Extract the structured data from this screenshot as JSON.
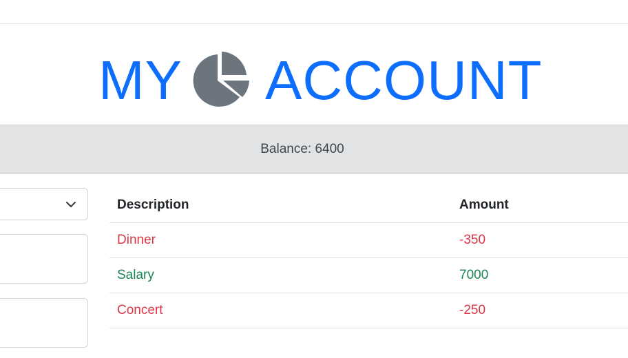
{
  "header": {
    "title_left": "MY",
    "title_right": "ACCOUNT",
    "icon": "pie-chart-icon"
  },
  "balance": {
    "text": "Balance: 6400"
  },
  "form": {
    "select_value": "",
    "input1_value": "",
    "input2_value": ""
  },
  "table": {
    "headers": [
      "Description",
      "Amount"
    ],
    "rows": [
      {
        "description": "Dinner",
        "amount": "-350",
        "type": "expense"
      },
      {
        "description": "Salary",
        "amount": "7000",
        "type": "income"
      },
      {
        "description": "Concert",
        "amount": "-250",
        "type": "expense"
      }
    ]
  },
  "colors": {
    "title": "#0d6efd",
    "icon": "#6c757d",
    "expense": "#dc3545",
    "income": "#198754",
    "balance_bg": "#e2e3e5"
  }
}
